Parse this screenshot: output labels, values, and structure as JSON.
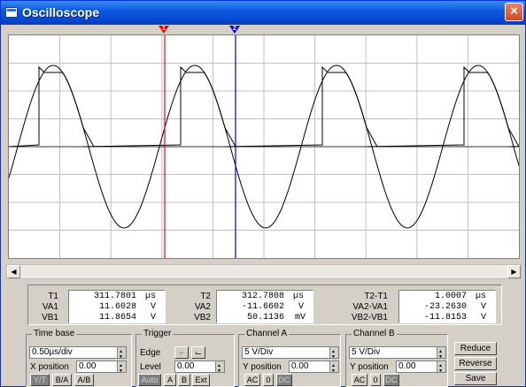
{
  "window": {
    "title": "Oscilloscope",
    "close": "×"
  },
  "markers": {
    "t1": "1",
    "t2": "2"
  },
  "readouts": {
    "col1": {
      "rows": [
        {
          "label": "T1",
          "value": "311.7801",
          "unit": "µs"
        },
        {
          "label": "VA1",
          "value": "11.6028",
          "unit": "V"
        },
        {
          "label": "VB1",
          "value": "11.8654",
          "unit": "V"
        }
      ]
    },
    "col2": {
      "rows": [
        {
          "label": "T2",
          "value": "312.7808",
          "unit": "µs"
        },
        {
          "label": "VA2",
          "value": "-11.6602",
          "unit": "V"
        },
        {
          "label": "VB2",
          "value": "50.1136",
          "unit": "mV"
        }
      ]
    },
    "col3": {
      "rows": [
        {
          "label": "T2-T1",
          "value": "1.0007",
          "unit": "µs"
        },
        {
          "label": "VA2-VA1",
          "value": "-23.2630",
          "unit": "V"
        },
        {
          "label": "VB2-VB1",
          "value": "-11.8153",
          "unit": "V"
        }
      ]
    }
  },
  "timebase": {
    "title": "Time base",
    "scale": "0.50µs/div",
    "xpos_label": "X position",
    "xpos": "0.00",
    "modes": [
      "Y/T",
      "B/A",
      "A/B"
    ]
  },
  "trigger": {
    "title": "Trigger",
    "edge_label": "Edge",
    "level_label": "Level",
    "level": "0.00",
    "sources": [
      "Auto",
      "A",
      "B",
      "Ext"
    ]
  },
  "channel_a": {
    "title": "Channel A",
    "scale": "5  V/Div",
    "ypos_label": "Y position",
    "ypos": "0.00",
    "coupling": [
      "AC",
      "0",
      "DC"
    ]
  },
  "channel_b": {
    "title": "Channel B",
    "scale": "5  V/Div",
    "ypos_label": "Y position",
    "ypos": "0.00",
    "coupling": [
      "AC",
      "0",
      "DC"
    ]
  },
  "actions": {
    "reduce": "Reduce",
    "reverse": "Reverse",
    "save": "Save"
  },
  "colors": {
    "cursor1": "#ee0000",
    "cursor2": "#0000e0",
    "grid": "#c0c0c0",
    "trace": "#000000"
  }
}
